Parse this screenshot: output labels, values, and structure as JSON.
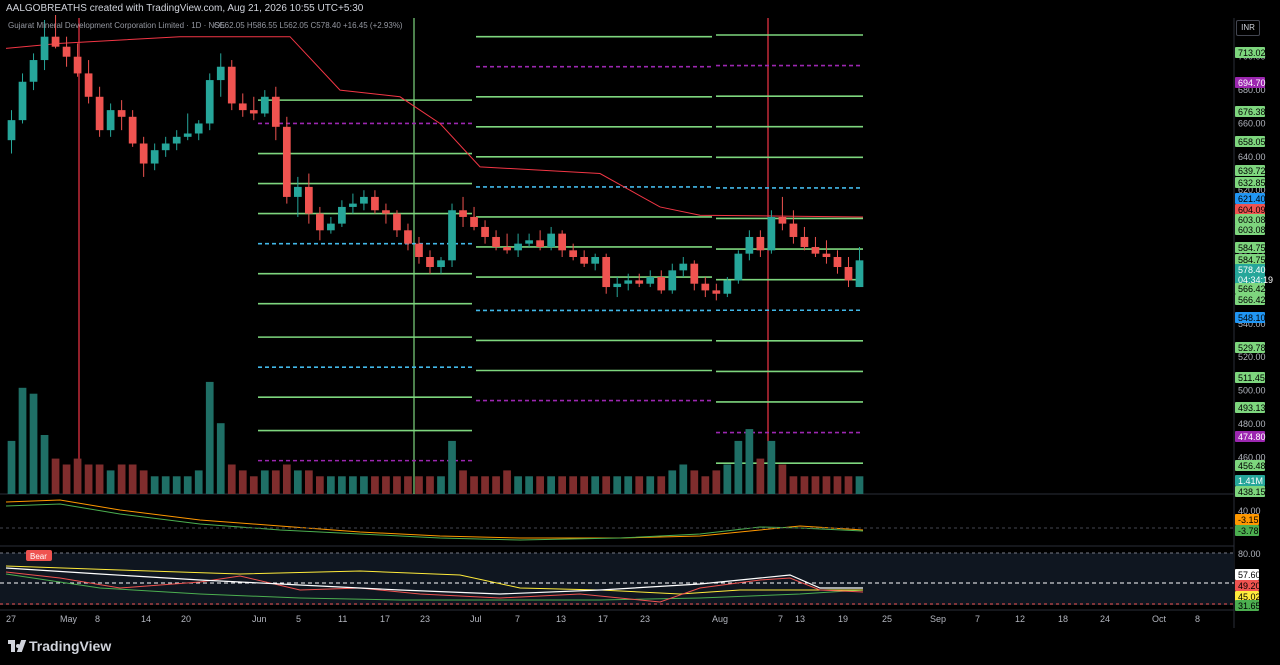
{
  "header": {
    "created_text": "AALGOBREATHS created with TradingView.com, Aug 21, 2026 10:55 UTC+5:30"
  },
  "legend": {
    "symbol_text": "Gujarat Mineral Development Corporation Limited · 1D · NSE",
    "ohlc_text": "O562.05 H586.55 L562.05 C578.40 +16.45 (+2.93%)"
  },
  "currency": "INR",
  "bear_tag": "Bear",
  "logo_text": "TradingView",
  "colors": {
    "up": "#26a69a",
    "down": "#ef5350",
    "level": "#7ed67e",
    "pivot": "#42b8e8",
    "outer": "#9c27b0",
    "trend": "#f23645"
  },
  "chart_data": [
    {
      "type": "line",
      "title": "Gujarat Mineral Development Corporation Limited",
      "xlabel": "",
      "ylabel": "",
      "price_ticks": [
        "700.00",
        "680.00",
        "660.00",
        "640.00",
        "620.00",
        "600.00",
        "580.00",
        "560.00",
        "540.00",
        "520.00",
        "500.00",
        "480.00",
        "460.00",
        "440.00"
      ],
      "price_range": [
        438,
        722
      ],
      "time_ticks": [
        "27",
        "May",
        "8",
        "14",
        "20",
        "Jun",
        "5",
        "11",
        "17",
        "23",
        "Jul",
        "7",
        "13",
        "17",
        "23",
        "Aug",
        "7",
        "13",
        "19",
        "25",
        "Sep",
        "7",
        "12",
        "18",
        "24",
        "Oct",
        "8"
      ],
      "candles": [
        {
          "o": 650,
          "h": 668,
          "l": 642,
          "c": 662
        },
        {
          "o": 662,
          "h": 690,
          "l": 660,
          "c": 685
        },
        {
          "o": 685,
          "h": 702,
          "l": 680,
          "c": 698
        },
        {
          "o": 698,
          "h": 722,
          "l": 692,
          "c": 712
        },
        {
          "o": 712,
          "h": 725,
          "l": 705,
          "c": 706
        },
        {
          "o": 706,
          "h": 712,
          "l": 694,
          "c": 700
        },
        {
          "o": 700,
          "h": 708,
          "l": 688,
          "c": 690
        },
        {
          "o": 690,
          "h": 698,
          "l": 672,
          "c": 676
        },
        {
          "o": 676,
          "h": 682,
          "l": 652,
          "c": 656
        },
        {
          "o": 656,
          "h": 672,
          "l": 652,
          "c": 668
        },
        {
          "o": 668,
          "h": 674,
          "l": 656,
          "c": 664
        },
        {
          "o": 664,
          "h": 668,
          "l": 646,
          "c": 648
        },
        {
          "o": 648,
          "h": 652,
          "l": 628,
          "c": 636
        },
        {
          "o": 636,
          "h": 648,
          "l": 632,
          "c": 644
        },
        {
          "o": 644,
          "h": 652,
          "l": 640,
          "c": 648
        },
        {
          "o": 648,
          "h": 656,
          "l": 644,
          "c": 652
        },
        {
          "o": 652,
          "h": 666,
          "l": 650,
          "c": 654
        },
        {
          "o": 654,
          "h": 662,
          "l": 650,
          "c": 660
        },
        {
          "o": 660,
          "h": 690,
          "l": 656,
          "c": 686
        },
        {
          "o": 686,
          "h": 702,
          "l": 676,
          "c": 694
        },
        {
          "o": 694,
          "h": 698,
          "l": 668,
          "c": 672
        },
        {
          "o": 672,
          "h": 678,
          "l": 664,
          "c": 668
        },
        {
          "o": 668,
          "h": 676,
          "l": 662,
          "c": 666
        },
        {
          "o": 666,
          "h": 680,
          "l": 664,
          "c": 676
        },
        {
          "o": 676,
          "h": 682,
          "l": 650,
          "c": 658
        },
        {
          "o": 658,
          "h": 664,
          "l": 612,
          "c": 616
        },
        {
          "o": 616,
          "h": 628,
          "l": 604,
          "c": 622
        },
        {
          "o": 622,
          "h": 630,
          "l": 600,
          "c": 606
        },
        {
          "o": 606,
          "h": 610,
          "l": 590,
          "c": 596
        },
        {
          "o": 596,
          "h": 604,
          "l": 594,
          "c": 600
        },
        {
          "o": 600,
          "h": 614,
          "l": 598,
          "c": 610
        },
        {
          "o": 610,
          "h": 618,
          "l": 606,
          "c": 612
        },
        {
          "o": 612,
          "h": 620,
          "l": 608,
          "c": 616
        },
        {
          "o": 616,
          "h": 620,
          "l": 606,
          "c": 608
        },
        {
          "o": 608,
          "h": 612,
          "l": 600,
          "c": 606
        },
        {
          "o": 606,
          "h": 608,
          "l": 592,
          "c": 596
        },
        {
          "o": 596,
          "h": 600,
          "l": 584,
          "c": 588
        },
        {
          "o": 588,
          "h": 592,
          "l": 576,
          "c": 580
        },
        {
          "o": 580,
          "h": 584,
          "l": 570,
          "c": 574
        },
        {
          "o": 574,
          "h": 580,
          "l": 570,
          "c": 578
        },
        {
          "o": 578,
          "h": 612,
          "l": 574,
          "c": 608
        },
        {
          "o": 608,
          "h": 616,
          "l": 598,
          "c": 604
        },
        {
          "o": 604,
          "h": 610,
          "l": 596,
          "c": 598
        },
        {
          "o": 598,
          "h": 602,
          "l": 588,
          "c": 592
        },
        {
          "o": 592,
          "h": 596,
          "l": 584,
          "c": 586
        },
        {
          "o": 586,
          "h": 594,
          "l": 582,
          "c": 584
        },
        {
          "o": 584,
          "h": 594,
          "l": 580,
          "c": 588
        },
        {
          "o": 588,
          "h": 594,
          "l": 586,
          "c": 590
        },
        {
          "o": 590,
          "h": 596,
          "l": 584,
          "c": 586
        },
        {
          "o": 586,
          "h": 598,
          "l": 584,
          "c": 594
        },
        {
          "o": 594,
          "h": 596,
          "l": 580,
          "c": 584
        },
        {
          "o": 584,
          "h": 588,
          "l": 578,
          "c": 580
        },
        {
          "o": 580,
          "h": 584,
          "l": 574,
          "c": 576
        },
        {
          "o": 576,
          "h": 582,
          "l": 572,
          "c": 580
        },
        {
          "o": 580,
          "h": 582,
          "l": 558,
          "c": 562
        },
        {
          "o": 562,
          "h": 568,
          "l": 556,
          "c": 564
        },
        {
          "o": 564,
          "h": 570,
          "l": 560,
          "c": 566
        },
        {
          "o": 566,
          "h": 570,
          "l": 562,
          "c": 564
        },
        {
          "o": 564,
          "h": 572,
          "l": 562,
          "c": 568
        },
        {
          "o": 568,
          "h": 572,
          "l": 558,
          "c": 560
        },
        {
          "o": 560,
          "h": 576,
          "l": 558,
          "c": 572
        },
        {
          "o": 572,
          "h": 580,
          "l": 568,
          "c": 576
        },
        {
          "o": 576,
          "h": 578,
          "l": 560,
          "c": 564
        },
        {
          "o": 564,
          "h": 568,
          "l": 556,
          "c": 560
        },
        {
          "o": 560,
          "h": 564,
          "l": 554,
          "c": 558
        },
        {
          "o": 558,
          "h": 568,
          "l": 556,
          "c": 566
        },
        {
          "o": 566,
          "h": 584,
          "l": 564,
          "c": 582
        },
        {
          "o": 582,
          "h": 596,
          "l": 578,
          "c": 592
        },
        {
          "o": 592,
          "h": 596,
          "l": 580,
          "c": 584
        },
        {
          "o": 584,
          "h": 608,
          "l": 582,
          "c": 604
        },
        {
          "o": 604,
          "h": 616,
          "l": 596,
          "c": 600
        },
        {
          "o": 600,
          "h": 608,
          "l": 588,
          "c": 592
        },
        {
          "o": 592,
          "h": 598,
          "l": 584,
          "c": 586
        },
        {
          "o": 586,
          "h": 592,
          "l": 580,
          "c": 582
        },
        {
          "o": 582,
          "h": 590,
          "l": 576,
          "c": 580
        },
        {
          "o": 580,
          "h": 584,
          "l": 570,
          "c": 574
        },
        {
          "o": 574,
          "h": 580,
          "l": 562,
          "c": 566
        },
        {
          "o": 562,
          "h": 586,
          "l": 562,
          "c": 578
        }
      ],
      "volume": [
        0.9,
        1.8,
        1.7,
        1.0,
        0.6,
        0.5,
        0.6,
        0.5,
        0.5,
        0.4,
        0.5,
        0.5,
        0.4,
        0.3,
        0.3,
        0.3,
        0.3,
        0.4,
        1.9,
        1.2,
        0.5,
        0.4,
        0.3,
        0.4,
        0.4,
        0.5,
        0.4,
        0.4,
        0.3,
        0.3,
        0.3,
        0.3,
        0.3,
        0.3,
        0.3,
        0.3,
        0.3,
        0.3,
        0.3,
        0.3,
        0.9,
        0.4,
        0.3,
        0.3,
        0.3,
        0.4,
        0.3,
        0.3,
        0.3,
        0.3,
        0.3,
        0.3,
        0.3,
        0.3,
        0.3,
        0.3,
        0.3,
        0.3,
        0.3,
        0.3,
        0.4,
        0.5,
        0.4,
        0.3,
        0.4,
        0.5,
        0.9,
        1.1,
        0.6,
        0.9,
        0.5,
        0.3,
        0.3,
        0.3,
        0.3,
        0.3,
        0.3,
        0.3
      ],
      "price_badges": [
        {
          "label": "713.02",
          "color": "#7ed67e",
          "text": "#000"
        },
        {
          "label": "694.70",
          "color": "#9c27b0",
          "text": "#fff"
        },
        {
          "label": "676.38",
          "color": "#7ed67e",
          "text": "#000"
        },
        {
          "label": "658.05",
          "color": "#7ed67e",
          "text": "#000"
        },
        {
          "label": "639.72",
          "color": "#7ed67e",
          "text": "#000"
        },
        {
          "label": "632.85",
          "color": "#7ed67e",
          "text": "#000"
        },
        {
          "label": "621.40",
          "color": "#2196f3",
          "text": "#000"
        },
        {
          "label": "604.09",
          "color": "#ef5350",
          "text": "#000"
        },
        {
          "label": "603.08",
          "color": "#7ed67e",
          "text": "#000"
        },
        {
          "label": "603.08",
          "color": "#7ed67e",
          "text": "#000"
        },
        {
          "label": "584.75",
          "color": "#7ed67e",
          "text": "#000"
        },
        {
          "label": "584.75",
          "color": "#7ed67e",
          "text": "#000"
        },
        {
          "label": "578.40",
          "color": "#26a69a",
          "text": "#fff"
        },
        {
          "label": "04:34:19",
          "color": "#26a69a",
          "text": "#fff"
        },
        {
          "label": "566.42",
          "color": "#7ed67e",
          "text": "#000"
        },
        {
          "label": "566.42",
          "color": "#7ed67e",
          "text": "#000"
        },
        {
          "label": "548.10",
          "color": "#2196f3",
          "text": "#000"
        },
        {
          "label": "529.78",
          "color": "#7ed67e",
          "text": "#000"
        },
        {
          "label": "511.45",
          "color": "#7ed67e",
          "text": "#000"
        },
        {
          "label": "493.13",
          "color": "#7ed67e",
          "text": "#000"
        },
        {
          "label": "474.80",
          "color": "#9c27b0",
          "text": "#fff"
        },
        {
          "label": "456.48",
          "color": "#7ed67e",
          "text": "#000"
        },
        {
          "label": "1.41M",
          "color": "#26a69a",
          "text": "#fff"
        },
        {
          "label": "438.15",
          "color": "#7ed67e",
          "text": "#000"
        }
      ],
      "levels_current": [
        713.02,
        694.7,
        676.38,
        658.05,
        639.72,
        621.4,
        603.08,
        584.75,
        566.42,
        548.1,
        529.78,
        511.45,
        493.13,
        474.8,
        456.48
      ]
    },
    {
      "type": "line",
      "title": "",
      "yticks": [
        "40.00"
      ],
      "value_badges": [
        {
          "label": "-3.15",
          "color": "#ff9800",
          "text": "#000"
        },
        {
          "label": "-3.78",
          "color": "#4caf50",
          "text": "#000"
        }
      ]
    },
    {
      "type": "line",
      "title": "",
      "yticks": [
        "80.00"
      ],
      "value_badges": [
        {
          "label": "57.60",
          "color": "#ffffff",
          "text": "#000"
        },
        {
          "label": "49.20",
          "color": "#ef5350",
          "text": "#000"
        },
        {
          "label": "45.02",
          "color": "#ffeb3b",
          "text": "#000"
        },
        {
          "label": "31.65",
          "color": "#4caf50",
          "text": "#000"
        }
      ]
    }
  ]
}
